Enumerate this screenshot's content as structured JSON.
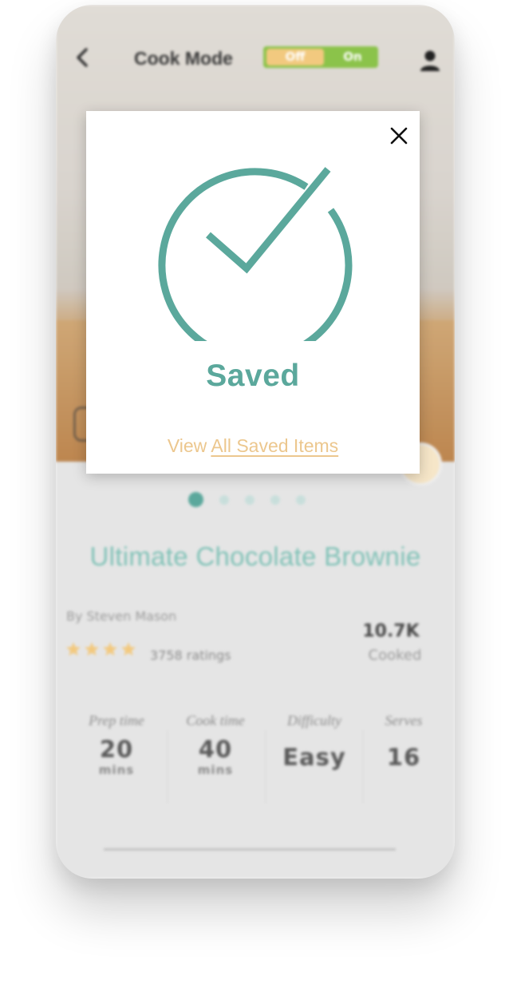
{
  "header": {
    "cook_mode_label": "Cook Mode",
    "toggle_off": "Off",
    "toggle_on": "On"
  },
  "pager": {
    "count": 5,
    "active_index": 0
  },
  "recipe": {
    "title": "Ultimate Chocolate Brownie",
    "author": "By Steven Mason",
    "ratings": "3758 ratings",
    "cooked_count": "10.7K",
    "cooked_label": "Cooked",
    "stats": [
      {
        "label": "Prep time",
        "value": "20",
        "unit": "mins"
      },
      {
        "label": "Cook time",
        "value": "40",
        "unit": "mins"
      },
      {
        "label": "Difficulty",
        "value": "Easy",
        "unit": ""
      },
      {
        "label": "Serves",
        "value": "16",
        "unit": ""
      }
    ]
  },
  "modal": {
    "title": "Saved",
    "view_prefix": "View",
    "view_link": "All Saved Items"
  },
  "icons": {
    "back": "chevron-left-icon",
    "user": "user-icon",
    "close": "close-icon",
    "check": "check-circle-icon",
    "star": "star-icon"
  },
  "colors": {
    "accent": "#5ba89c",
    "link": "#ecc78e",
    "toggle_on": "#8bc34a",
    "toggle_off": "#f2c97f",
    "star": "#f2c97f"
  }
}
